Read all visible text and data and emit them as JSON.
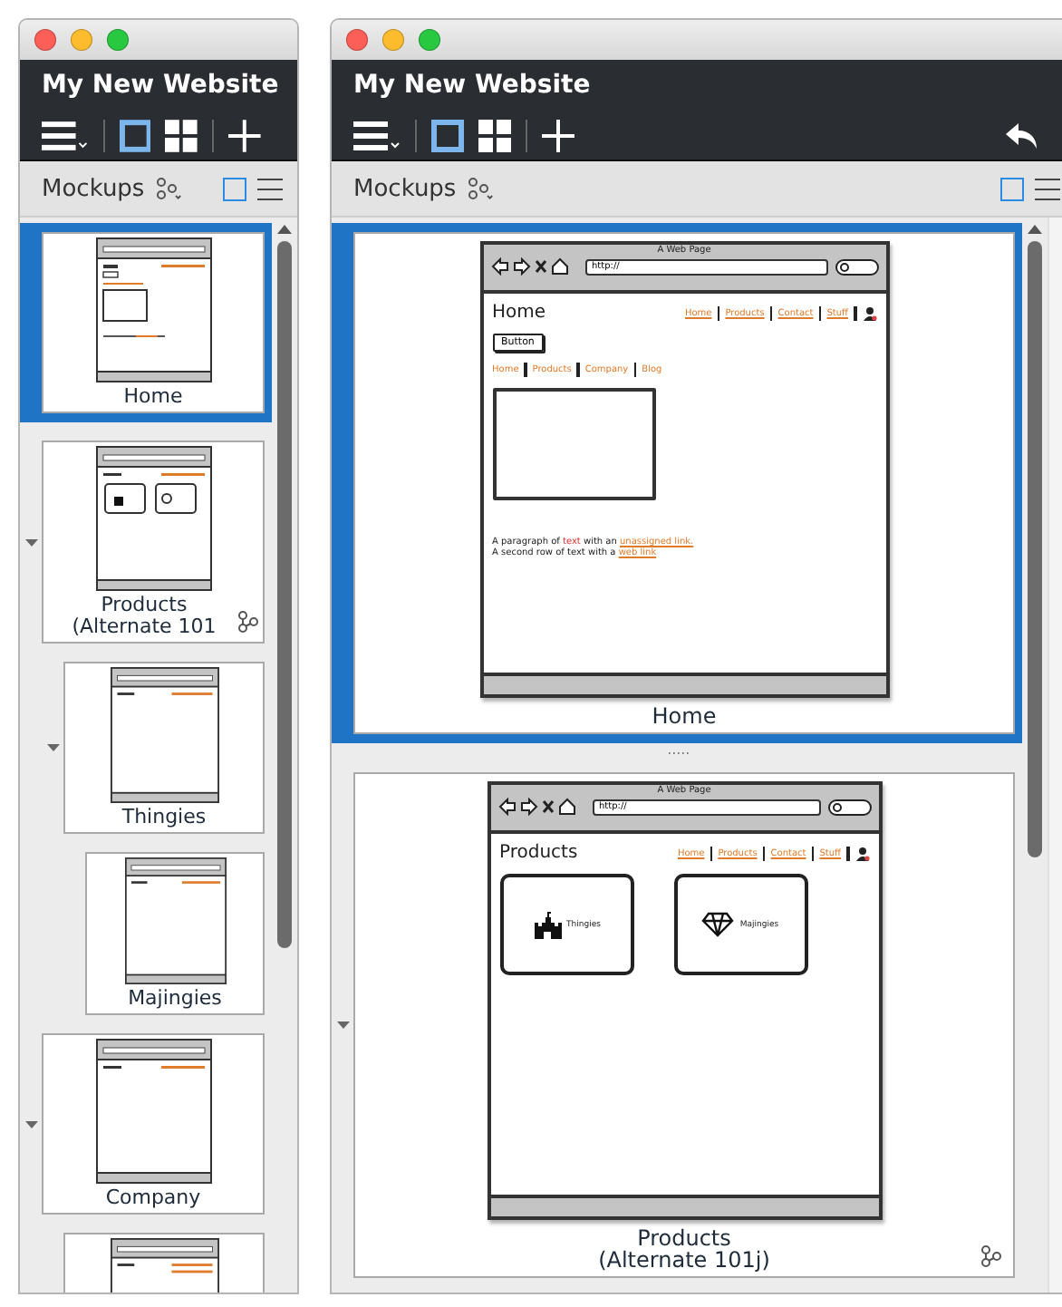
{
  "windows": [
    {
      "title": "My New Website",
      "layout_buttons": [
        {
          "kind": "single",
          "selected": true
        },
        {
          "kind": "grid",
          "selected": false
        }
      ],
      "panel_title": "Mockups",
      "panel_view_buttons": [
        {
          "kind": "thumbnails",
          "selected": true
        },
        {
          "kind": "list",
          "selected": false
        }
      ],
      "mockups": [
        {
          "label": [
            "Home"
          ],
          "selected": true,
          "kind": "home"
        },
        {
          "label": [
            "Products",
            "(Alternate 101"
          ],
          "selected": false,
          "kind": "products",
          "alternates": true,
          "expanded": true,
          "children": [
            {
              "label": [
                "Thingies"
              ],
              "selected": false,
              "kind": "list",
              "expanded": true,
              "children": [
                {
                  "label": [
                    "Majingies"
                  ],
                  "selected": false,
                  "kind": "list"
                }
              ]
            }
          ]
        },
        {
          "label": [
            "Company"
          ],
          "selected": false,
          "kind": "list",
          "expanded": true,
          "children": [
            {
              "selected": false,
              "kind": "list2"
            }
          ]
        }
      ]
    },
    {
      "title": "My New Website",
      "layout_buttons": [
        {
          "kind": "single",
          "selected": true
        },
        {
          "kind": "grid",
          "selected": false
        }
      ],
      "show_undo": true,
      "panel_title": "Mockups",
      "panel_view_buttons": [
        {
          "kind": "thumbnails",
          "selected": true
        },
        {
          "kind": "list",
          "selected": false
        }
      ],
      "mockups": [
        {
          "label": [
            "Home"
          ],
          "selected": true,
          "kind": "home",
          "page": {
            "browser_title": "A Web Page",
            "url": "http://",
            "heading": "Home",
            "top_links": [
              "Home",
              "Products",
              "Contact",
              "Stuff"
            ],
            "button": "Button",
            "nav": [
              "Home",
              "Products",
              "Company",
              "Blog"
            ],
            "paragraph": [
              [
                {
                  "text": "A paragraph of "
                },
                {
                  "text": "text",
                  "kind": "emph"
                },
                {
                  "text": " with an "
                },
                {
                  "text": "unassigned link.",
                  "kind": "link"
                }
              ],
              [
                {
                  "text": "A second row of text with a "
                },
                {
                  "text": "web link",
                  "kind": "link"
                }
              ]
            ]
          }
        },
        {
          "label": [
            "Products",
            "(Alternate 101j)"
          ],
          "selected": false,
          "kind": "products",
          "alternates": true,
          "expanded": true,
          "page": {
            "browser_title": "A Web Page",
            "url": "http://",
            "heading": "Products",
            "top_links": [
              "Home",
              "Products",
              "Contact",
              "Stuff"
            ],
            "tiles": [
              {
                "kind": "castle",
                "label": "Thingies"
              },
              {
                "kind": "diamond",
                "label": "Majingies"
              }
            ]
          }
        }
      ]
    }
  ]
}
